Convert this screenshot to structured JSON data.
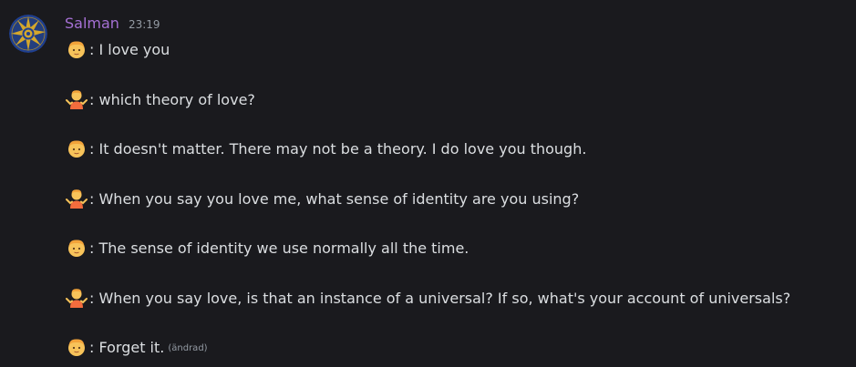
{
  "message": {
    "username": "Salman",
    "timestamp": "23:19",
    "edited_label": "(ändrad)",
    "lines": [
      {
        "speaker_icon": "face-emoji",
        "text": ": I love you"
      },
      {
        "speaker_icon": "person-shrugging-emoji",
        "text": ": which theory of love?"
      },
      {
        "speaker_icon": "face-emoji",
        "text": ": It doesn't matter. There may not be a theory. I do love you though."
      },
      {
        "speaker_icon": "person-shrugging-emoji",
        "text": ": When you say you love me, what sense of identity are you using?"
      },
      {
        "speaker_icon": "face-emoji",
        "text": ": The sense of identity we use normally all the time."
      },
      {
        "speaker_icon": "person-shrugging-emoji",
        "text": ": When you say love, is that an instance of a universal? If so, what's your account of universals?"
      },
      {
        "speaker_icon": "face-emoji",
        "text": ": Forget it."
      }
    ]
  },
  "colors": {
    "background": "#1a1a1e",
    "username": "#a570d4",
    "text": "#dbdee1",
    "muted": "#949ba4",
    "avatar_bg": "#1f3f8f",
    "avatar_star": "#d4a72c"
  }
}
